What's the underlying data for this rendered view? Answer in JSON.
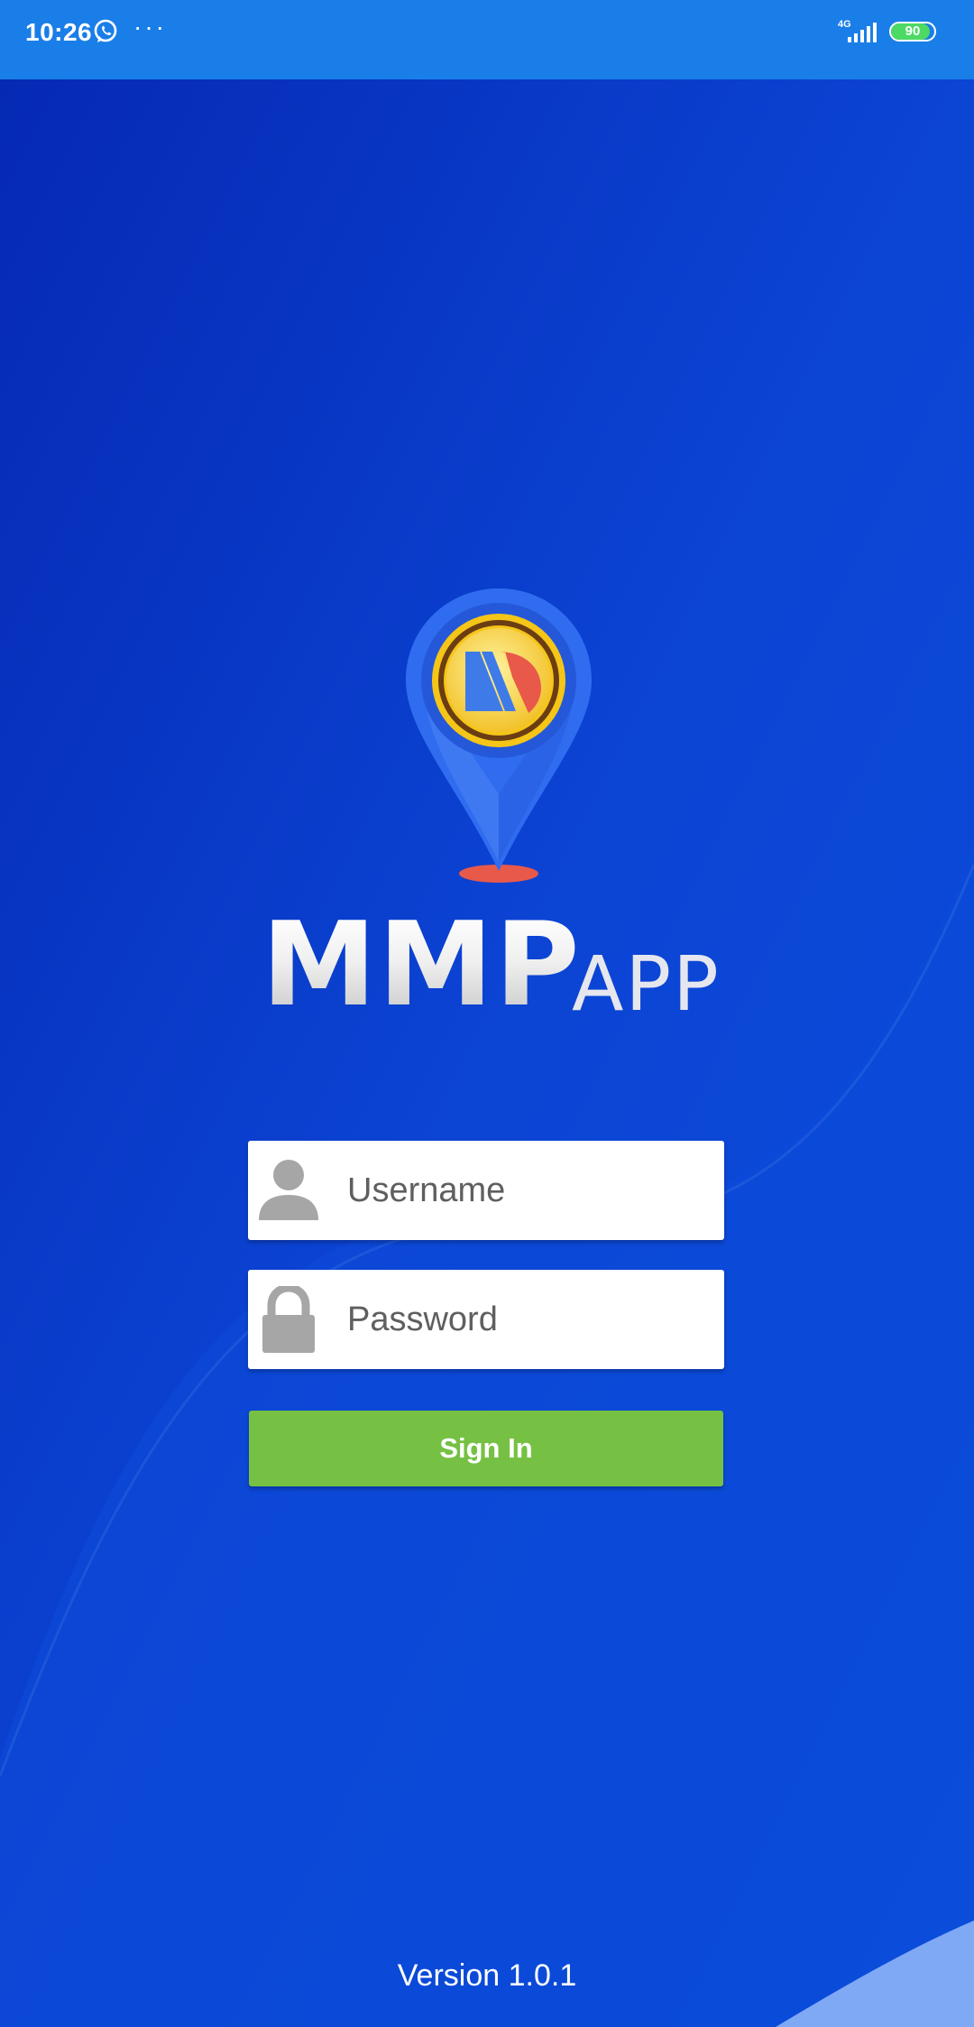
{
  "status_bar": {
    "time": "10:26",
    "network": "4G",
    "battery": "90",
    "battery_level": 0.9,
    "notification_icons": [
      "whatsapp-icon",
      "more-dots-icon"
    ],
    "dots": "···"
  },
  "logo": {
    "primary": "MMP",
    "secondary": "APP"
  },
  "login_form": {
    "username_placeholder": "Username",
    "password_placeholder": "Password",
    "signin_label": "Sign In"
  },
  "footer": {
    "version": "Version 1.0.1"
  },
  "colors": {
    "status_bar": "#1a7ee8",
    "background": "#0a3fd0",
    "signin_button": "#76c144",
    "pin": "#2f6cf0",
    "coin_ring": "#f5c518"
  }
}
